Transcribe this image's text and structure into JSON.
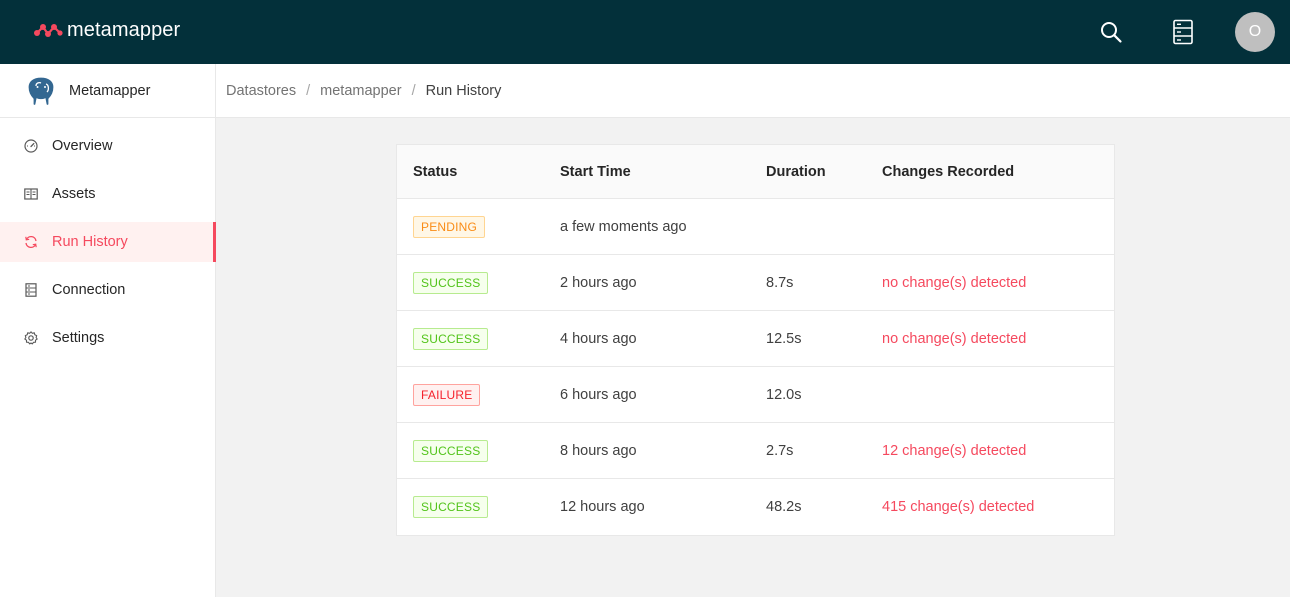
{
  "app": {
    "name": "metamapper",
    "user_initial": "O",
    "colors": {
      "topbar": "#03303a",
      "accent": "#f5495e"
    },
    "icons": {
      "logo": "metamapper-logo-icon",
      "search": "search-icon",
      "datastores": "datastores-icon"
    }
  },
  "sidebar": {
    "datastore_name": "Metamapper",
    "datastore_icon": "postgresql-elephant-icon",
    "items": [
      {
        "label": "Overview",
        "icon": "dashboard-icon",
        "active": false
      },
      {
        "label": "Assets",
        "icon": "book-icon",
        "active": false
      },
      {
        "label": "Run History",
        "icon": "sync-icon",
        "active": true
      },
      {
        "label": "Connection",
        "icon": "database-icon",
        "active": false
      },
      {
        "label": "Settings",
        "icon": "gear-icon",
        "active": false
      }
    ]
  },
  "breadcrumb": [
    "Datastores",
    "metamapper",
    "Run History"
  ],
  "table": {
    "columns": [
      "Status",
      "Start Time",
      "Duration",
      "Changes Recorded"
    ],
    "rows": [
      {
        "status": "PENDING",
        "start_time": "a few moments ago",
        "duration": "",
        "changes": ""
      },
      {
        "status": "SUCCESS",
        "start_time": "2 hours ago",
        "duration": "8.7s",
        "changes": "no change(s) detected"
      },
      {
        "status": "SUCCESS",
        "start_time": "4 hours ago",
        "duration": "12.5s",
        "changes": "no change(s) detected"
      },
      {
        "status": "FAILURE",
        "start_time": "6 hours ago",
        "duration": "12.0s",
        "changes": ""
      },
      {
        "status": "SUCCESS",
        "start_time": "8 hours ago",
        "duration": "2.7s",
        "changes": "12 change(s) detected"
      },
      {
        "status": "SUCCESS",
        "start_time": "12 hours ago",
        "duration": "48.2s",
        "changes": "415 change(s) detected"
      }
    ]
  }
}
